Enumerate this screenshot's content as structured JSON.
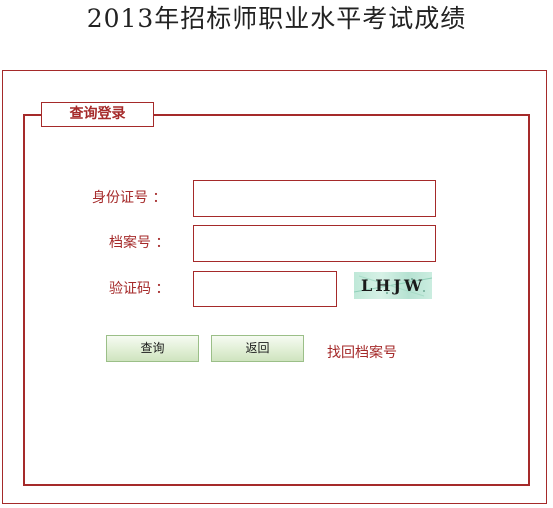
{
  "page": {
    "title": "2013年招标师职业水平考试成绩"
  },
  "login_panel": {
    "legend": "查询登录",
    "id_label": "身份证号 ：",
    "id_value": "",
    "file_label": "档案号 ：",
    "file_value": "",
    "captcha_label": "验证码 ：",
    "captcha_value": "",
    "captcha_image_text": "LHJW"
  },
  "actions": {
    "query_label": "查询",
    "back_label": "返回",
    "recover_link": "找回档案号"
  },
  "colors": {
    "accent": "#a52a2a",
    "button_border": "#9bbf88",
    "captcha_bg": "#c6ecdc"
  }
}
